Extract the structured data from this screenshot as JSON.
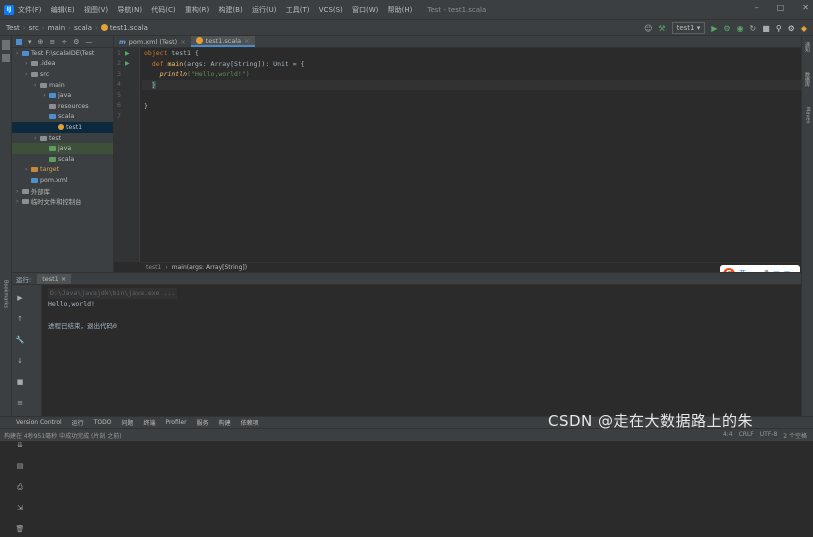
{
  "titlebar": {
    "menu": [
      "文件(F)",
      "编辑(E)",
      "视图(V)",
      "导航(N)",
      "代码(C)",
      "重构(R)",
      "构建(B)",
      "运行(U)",
      "工具(T)",
      "VCS(S)",
      "窗口(W)",
      "帮助(H)"
    ],
    "window_title": "Test - test1.scala"
  },
  "navbar": {
    "crumbs": [
      "Test",
      "src",
      "main",
      "scala",
      "test1.scala"
    ],
    "run_config": "test1"
  },
  "project": {
    "root_label": "Test",
    "root_path": "F:\\scala\\IDE\\Test",
    "items": [
      {
        "label": "Test F:\\scalaIDE\\Test",
        "indent": 0,
        "icon": "folder-blue"
      },
      {
        "label": ".idea",
        "indent": 1,
        "icon": "folder"
      },
      {
        "label": "src",
        "indent": 1,
        "icon": "folder"
      },
      {
        "label": "main",
        "indent": 2,
        "icon": "folder"
      },
      {
        "label": "java",
        "indent": 3,
        "icon": "folder-blue"
      },
      {
        "label": "resources",
        "indent": 3,
        "icon": "folder"
      },
      {
        "label": "scala",
        "indent": 3,
        "icon": "folder-blue"
      },
      {
        "label": "test1",
        "indent": 4,
        "icon": "scala"
      },
      {
        "label": "test",
        "indent": 2,
        "icon": "folder"
      },
      {
        "label": "java",
        "indent": 3,
        "icon": "folder-green"
      },
      {
        "label": "scala",
        "indent": 3,
        "icon": "folder-green"
      },
      {
        "label": "target",
        "indent": 1,
        "icon": "folder-orange"
      },
      {
        "label": "pom.xml",
        "indent": 1,
        "icon": "file"
      },
      {
        "label": "外部库",
        "indent": 0,
        "icon": "folder"
      },
      {
        "label": "临时文件和控制台",
        "indent": 0,
        "icon": "folder"
      }
    ]
  },
  "tabs": [
    {
      "label": "pom.xml (Test)",
      "active": false
    },
    {
      "label": "test1.scala",
      "active": true
    }
  ],
  "code": {
    "line_numbers": [
      "1",
      "2",
      "3",
      "4",
      "5",
      "6",
      "7"
    ],
    "line1_kw": "object",
    "line1_name": " test1 {",
    "line2_kw": "def",
    "line2_fn": " main",
    "line2_rest": "(args: Array[String]): Unit = {",
    "line3_fn": "println",
    "line3_str": "(\"Hello,world!\")",
    "line4": "}",
    "line6": "}"
  },
  "crumbbar": {
    "obj": "test1",
    "method": "main(args: Array[String])"
  },
  "run": {
    "header_label": "运行:",
    "tab_label": "test1",
    "cmd": "D:\\Java\\javajdk\\bin\\java.exe ...",
    "output": "Hello,world!",
    "exit": "进程已结束，退出代码0"
  },
  "bottombar": [
    "Version Control",
    "运行",
    "TODO",
    "问题",
    "终端",
    "Profiler",
    "服务",
    "构建",
    "依赖项"
  ],
  "statusbar": {
    "left": "构建在 4秒951毫秒 中成功完成 (片刻 之前)",
    "right": [
      "4:4",
      "CRLF",
      "UTF-8",
      "2 个空格"
    ]
  },
  "ime": {
    "label": "英"
  },
  "watermark": "CSDN @走在大数据路上的朱",
  "rightbar": [
    "通知",
    "数据库",
    "Maven"
  ],
  "colors": {
    "accent": "#4a88c7",
    "run_green": "#59a869",
    "keyword": "#cc7832",
    "function": "#ffc66d",
    "string": "#6a8759"
  }
}
